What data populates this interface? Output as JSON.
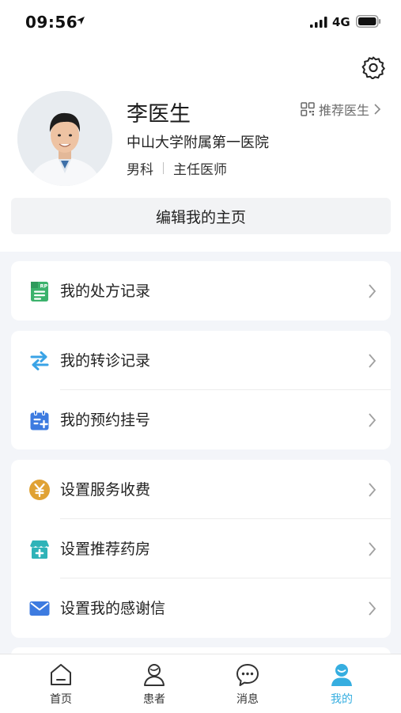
{
  "status_bar": {
    "time": "09:56",
    "network": "4G"
  },
  "profile": {
    "name": "李医生",
    "recommend_label": "推荐医生",
    "hospital": "中山大学附属第一医院",
    "department": "男科",
    "title": "主任医师",
    "edit_label": "编辑我的主页"
  },
  "menu": {
    "groups": [
      {
        "items": [
          {
            "label": "我的处方记录",
            "icon": "prescription-icon"
          }
        ]
      },
      {
        "items": [
          {
            "label": "我的转诊记录",
            "icon": "transfer-icon"
          },
          {
            "label": "我的预约挂号",
            "icon": "calendar-icon"
          }
        ]
      },
      {
        "items": [
          {
            "label": "设置服务收费",
            "icon": "yen-icon"
          },
          {
            "label": "设置推荐药房",
            "icon": "pharmacy-icon"
          },
          {
            "label": "设置我的感谢信",
            "icon": "mail-icon"
          }
        ]
      }
    ]
  },
  "tabbar": {
    "tabs": [
      {
        "label": "首页",
        "icon": "home-icon"
      },
      {
        "label": "患者",
        "icon": "patient-icon"
      },
      {
        "label": "消息",
        "icon": "message-icon"
      },
      {
        "label": "我的",
        "icon": "profile-icon",
        "active": true
      }
    ]
  },
  "colors": {
    "accent": "#36aee0",
    "green": "#3bb26c",
    "blue": "#3d7be0",
    "gold": "#e0a234",
    "teal": "#2fb3b8"
  }
}
